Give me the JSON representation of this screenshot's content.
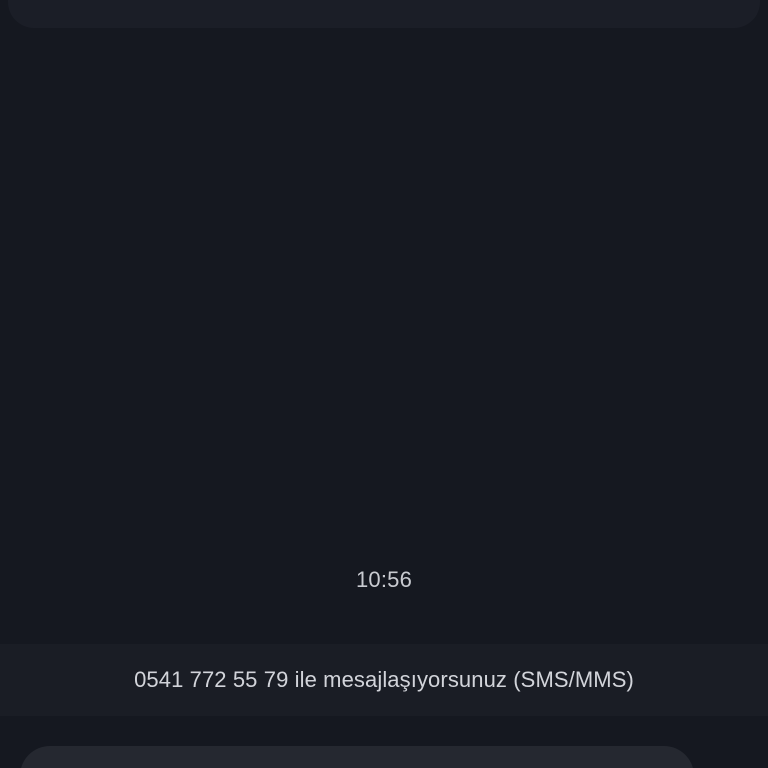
{
  "conversation": {
    "timestamp": "10:56"
  },
  "info_bar": {
    "text": "0541 772 55 79 ile mesajlaşıyorsunuz (SMS/MMS)"
  },
  "colors": {
    "background": "#151820",
    "info_bar_background": "#1a1d25",
    "compose_background": "#252830",
    "text": "#d2d4da"
  }
}
